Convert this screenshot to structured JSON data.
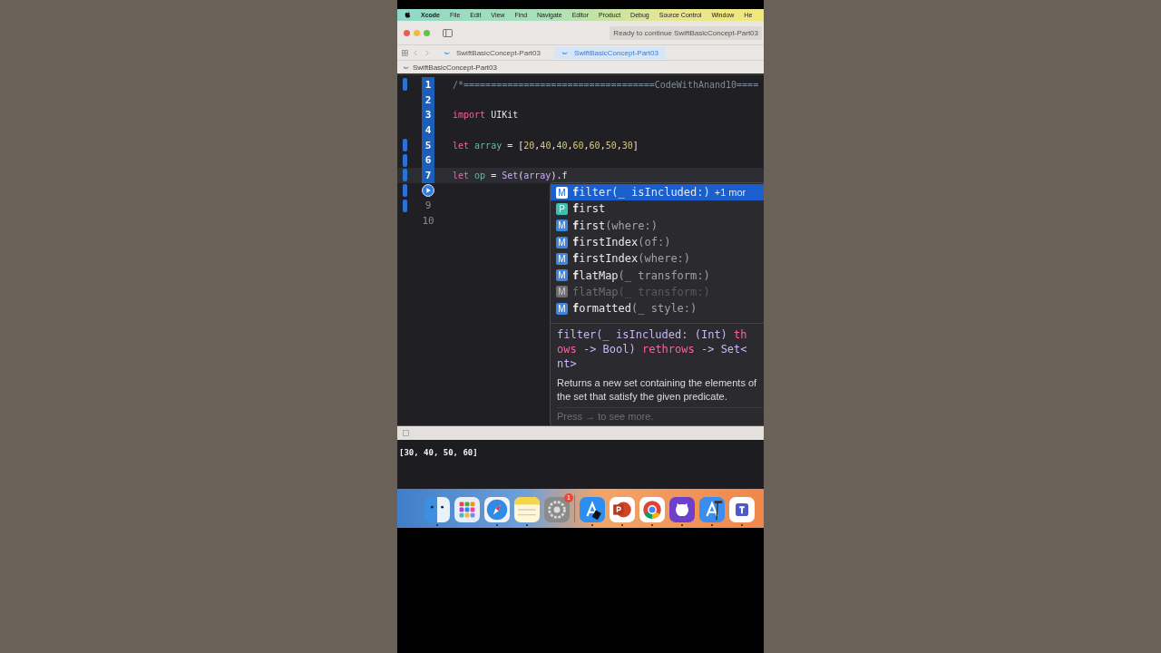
{
  "menu_bar": {
    "items": [
      "Xcode",
      "File",
      "Edit",
      "View",
      "Find",
      "Navigate",
      "Editor",
      "Product",
      "Debug",
      "Source Control",
      "Window",
      "He"
    ]
  },
  "toolbar": {
    "status": "Ready to continue SwiftBasicConcept-Part03"
  },
  "tabs": [
    {
      "label": "SwiftBasicConcept-Part03",
      "selected": false
    },
    {
      "label": "SwiftBasicConcept-Part03",
      "selected": true
    }
  ],
  "breadcrumb": "SwiftBasicConcept-Part03",
  "editor": {
    "lines": [
      {
        "number": "1",
        "kind": "number",
        "highlighted": true,
        "changed": true,
        "current": false,
        "tokens": [
          {
            "text": "/*===================================CodeWithAnand10====",
            "kind": "comment"
          }
        ]
      },
      {
        "number": "2",
        "kind": "number",
        "highlighted": true,
        "changed": false,
        "current": false
      },
      {
        "number": "3",
        "kind": "number",
        "highlighted": true,
        "changed": false,
        "current": false,
        "tokens": [
          {
            "text": "import",
            "kind": "keyword"
          },
          {
            "text": " UIKit",
            "kind": "plain"
          }
        ]
      },
      {
        "number": "4",
        "kind": "number",
        "highlighted": true,
        "changed": false,
        "current": false
      },
      {
        "number": "5",
        "kind": "number",
        "highlighted": true,
        "changed": true,
        "current": false,
        "tokens": [
          {
            "text": "let",
            "kind": "keyword"
          },
          {
            "text": " array",
            "kind": "ident"
          },
          {
            "text": " = [",
            "kind": "plain"
          },
          {
            "text": "20",
            "kind": "number"
          },
          {
            "text": ",",
            "kind": "plain"
          },
          {
            "text": "40",
            "kind": "number"
          },
          {
            "text": ",",
            "kind": "plain"
          },
          {
            "text": "40",
            "kind": "number"
          },
          {
            "text": ",",
            "kind": "plain"
          },
          {
            "text": "60",
            "kind": "number"
          },
          {
            "text": ",",
            "kind": "plain"
          },
          {
            "text": "60",
            "kind": "number"
          },
          {
            "text": ",",
            "kind": "plain"
          },
          {
            "text": "50",
            "kind": "number"
          },
          {
            "text": ",",
            "kind": "plain"
          },
          {
            "text": "30",
            "kind": "number"
          },
          {
            "text": "]",
            "kind": "plain"
          }
        ]
      },
      {
        "number": "6",
        "kind": "number",
        "highlighted": true,
        "changed": true,
        "current": false
      },
      {
        "number": "7",
        "kind": "number",
        "highlighted": true,
        "changed": true,
        "current": true,
        "tokens": [
          {
            "text": "let",
            "kind": "keyword"
          },
          {
            "text": " op",
            "kind": "ident"
          },
          {
            "text": " = ",
            "kind": "plain"
          },
          {
            "text": "Set",
            "kind": "type"
          },
          {
            "text": "(",
            "kind": "plain"
          },
          {
            "text": "array",
            "kind": "type"
          },
          {
            "text": ").f",
            "kind": "plain"
          }
        ]
      },
      {
        "kind": "run",
        "highlighted": false,
        "changed": true,
        "current": false
      },
      {
        "number": "9",
        "kind": "number",
        "highlighted": false,
        "changed": true,
        "current": false
      },
      {
        "number": "10",
        "kind": "number",
        "highlighted": false,
        "changed": false,
        "current": false
      }
    ]
  },
  "completion": {
    "items": [
      {
        "badge": "M",
        "typed": "f",
        "name": "ilter",
        "args": "(_ isIncluded:)",
        "extra": "+1 mor",
        "selected": true,
        "disabled": false
      },
      {
        "badge": "P",
        "typed": "f",
        "name": "irst",
        "selected": false,
        "disabled": false
      },
      {
        "badge": "M",
        "typed": "f",
        "name": "irst",
        "args": "(where:)",
        "selected": false,
        "disabled": false
      },
      {
        "badge": "M",
        "typed": "f",
        "name": "irstIndex",
        "args": "(of:)",
        "selected": false,
        "disabled": false
      },
      {
        "badge": "M",
        "typed": "f",
        "name": "irstIndex",
        "args": "(where:)",
        "selected": false,
        "disabled": false
      },
      {
        "badge": "M",
        "typed": "f",
        "name": "latMap",
        "args": "(_ transform:)",
        "selected": false,
        "disabled": false
      },
      {
        "badge": "M",
        "typed": "f",
        "name": "latMap",
        "args": "(_ transform:)",
        "selected": false,
        "disabled": true
      },
      {
        "badge": "M",
        "typed": "f",
        "name": "ormatted",
        "args": "(_ style:)",
        "selected": false,
        "disabled": false
      }
    ],
    "signature": [
      [
        {
          "text": "filter(_ isIncluded: (Int) ",
          "kind": "plain"
        },
        {
          "text": "th",
          "kind": "keyword"
        }
      ],
      [
        {
          "text": "ows",
          "kind": "keyword"
        },
        {
          "text": " -> Bool) ",
          "kind": "plain"
        },
        {
          "text": "rethrows",
          "kind": "keyword"
        },
        {
          "text": " -> Set<",
          "kind": "plain"
        }
      ],
      [
        {
          "text": "nt>",
          "kind": "plain"
        }
      ]
    ],
    "description": "Returns a new set containing the elements of the set that satisfy the given predicate.",
    "hint": "Press → to see more."
  },
  "console": {
    "output": "[30, 40, 50, 60]"
  },
  "dock": {
    "apps": [
      {
        "kind": "face",
        "running": true
      },
      {
        "kind": "grid",
        "running": false
      },
      {
        "kind": "compass",
        "running": true
      },
      {
        "kind": "notes",
        "running": true
      },
      {
        "kind": "gear",
        "running": false,
        "badge": "1"
      },
      {
        "kind": "store",
        "running": true
      },
      {
        "kind": "slides",
        "running": true
      },
      {
        "kind": "browser",
        "running": true
      },
      {
        "kind": "cat",
        "running": true
      },
      {
        "kind": "hammer",
        "running": true
      },
      {
        "kind": "chat",
        "running": true
      }
    ]
  }
}
